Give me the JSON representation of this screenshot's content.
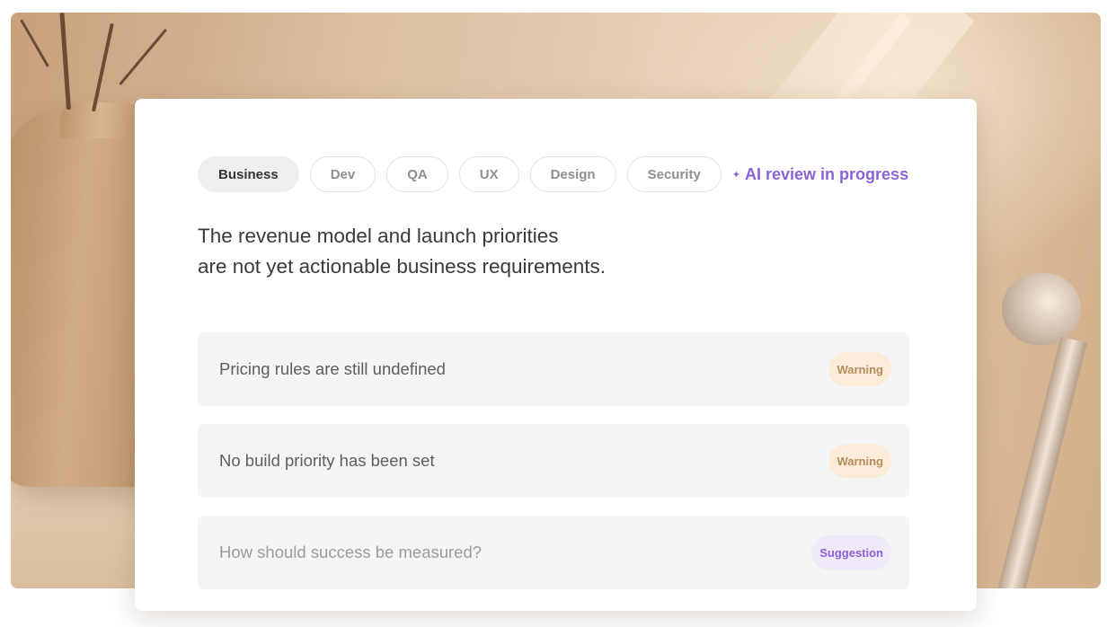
{
  "tabs": [
    {
      "label": "Business",
      "active": true
    },
    {
      "label": "Dev"
    },
    {
      "label": "QA"
    },
    {
      "label": "UX"
    },
    {
      "label": "Design"
    },
    {
      "label": "Security"
    }
  ],
  "ai_status": {
    "icon": "sparkle-icon",
    "label": "AI review in progress",
    "color": "#8a63d6"
  },
  "headline": {
    "line1": "The revenue model and launch priorities",
    "line2": "are not yet actionable business requirements."
  },
  "issues": [
    {
      "text": "Pricing rules are still undefined",
      "badge": "Warning"
    },
    {
      "text": "No build priority has been set",
      "badge": "Warning"
    },
    {
      "text": "How should success be measured?",
      "badge": "Suggestion"
    }
  ],
  "colors": {
    "warning_bg": "#fbebd8",
    "warning_text": "#b58e5c",
    "suggestion_bg": "#f0e9fa",
    "suggestion_text": "#8a63d6"
  }
}
